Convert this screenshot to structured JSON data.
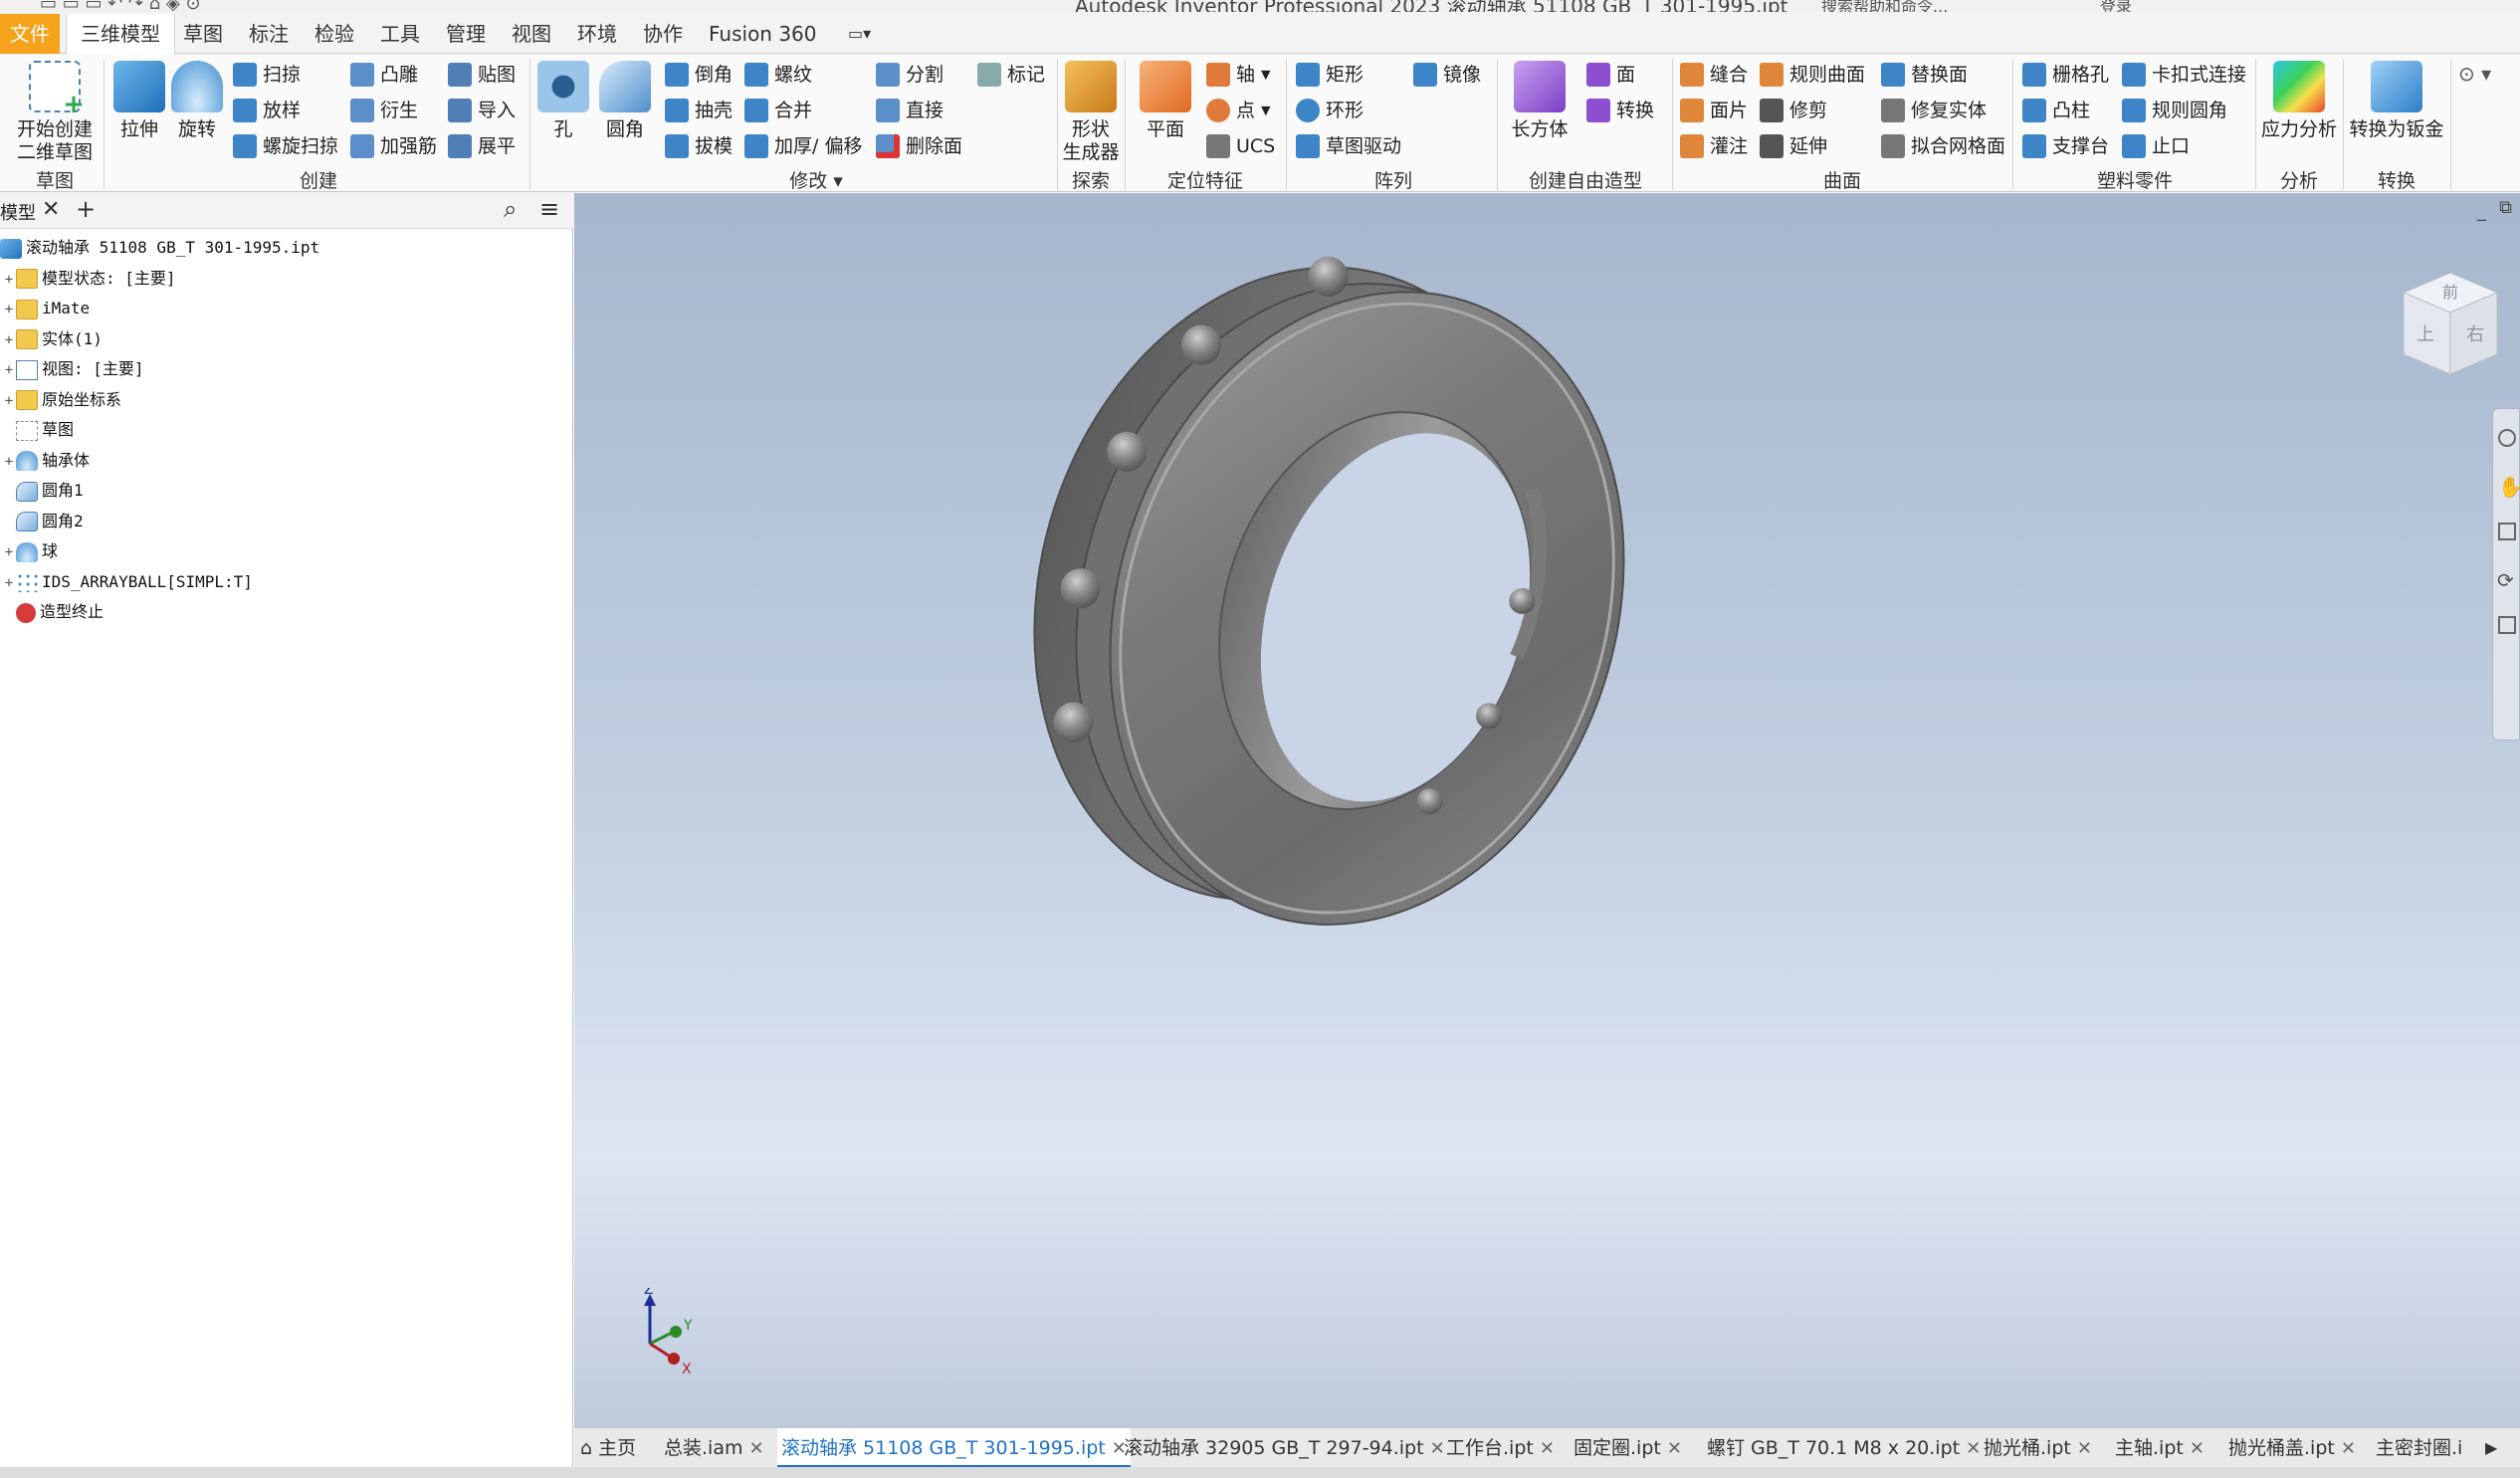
{
  "titlebar": {
    "title": "Autodesk Inventor Professional 2023   滚动轴承 51108 GB_T 301-1995.ipt",
    "search": "搜索帮助和命令...",
    "signin": "登录"
  },
  "menu": {
    "file": "文件",
    "tabs": [
      "三维模型",
      "草图",
      "标注",
      "检验",
      "工具",
      "管理",
      "视图",
      "环境",
      "协作",
      "Fusion 360"
    ],
    "active_tab": "三维模型"
  },
  "ribbon": {
    "sketch": {
      "start_2d": "开始创建\n二维草图",
      "group": "草图"
    },
    "create": {
      "extrude": "拉伸",
      "revolve": "旋转",
      "sweep": "扫掠",
      "loft": "放样",
      "coil": "螺旋扫掠",
      "emboss": "凸雕",
      "derive": "衍生",
      "rib": "加强筋",
      "decal": "贴图",
      "import": "导入",
      "unfold": "展平",
      "group": "创建"
    },
    "modify": {
      "hole": "孔",
      "fillet": "圆角",
      "chamfer": "倒角",
      "shell": "抽壳",
      "draft": "拔模",
      "thread": "螺纹",
      "combine": "合并",
      "thicken": "加厚/ 偏移",
      "split": "分割",
      "direct": "直接",
      "delete_face": "删除面",
      "mark": "标记",
      "group": "修改"
    },
    "explore": {
      "shape_gen": "形状\n生成器",
      "group": "探索"
    },
    "work": {
      "plane": "平面",
      "axis": "轴",
      "point": "点",
      "ucs": "UCS",
      "group": "定位特征"
    },
    "pattern": {
      "rect": "矩形",
      "circ": "环形",
      "sketch_driven": "草图驱动",
      "mirror": "镜像",
      "group": "阵列"
    },
    "freeform": {
      "box": "长方体",
      "face": "面",
      "convert": "转换",
      "group": "创建自由造型"
    },
    "surface": {
      "stitch": "缝合",
      "patch": "面片",
      "sculpt": "灌注",
      "ruled": "规则曲面",
      "trim": "修剪",
      "extend": "延伸",
      "replace": "替换面",
      "repair": "修复实体",
      "fit_mesh": "拟合网格面",
      "group": "曲面"
    },
    "plastic": {
      "grill": "栅格孔",
      "boss": "凸柱",
      "rest": "支撑台",
      "snap": "卡扣式连接",
      "rule_fillet": "规则圆角",
      "lip": "止口",
      "group": "塑料零件"
    },
    "analysis": {
      "stress": "应力分析",
      "group": "分析"
    },
    "convert": {
      "to_sheet": "转换为钣金",
      "group": "转换"
    }
  },
  "browser": {
    "tab_label": "模型",
    "rows": [
      {
        "label": "滚动轴承 51108 GB_T 301-1995.ipt",
        "icon": "part-icon",
        "exp": ""
      },
      {
        "label": "模型状态: [主要]",
        "icon": "folder-icon",
        "exp": "+"
      },
      {
        "label": "iMate",
        "icon": "folder-icon",
        "exp": "+"
      },
      {
        "label": "实体(1)",
        "icon": "folder-icon",
        "exp": "+"
      },
      {
        "label": "视图: [主要]",
        "icon": "view-icon",
        "exp": "+"
      },
      {
        "label": "原始坐标系",
        "icon": "folder-icon",
        "exp": "+"
      },
      {
        "label": "草图",
        "icon": "sketch-icon",
        "exp": ""
      },
      {
        "label": "轴承体",
        "icon": "revolve-icon",
        "exp": "+"
      },
      {
        "label": "圆角1",
        "icon": "fillet-icon",
        "exp": ""
      },
      {
        "label": "圆角2",
        "icon": "fillet-icon",
        "exp": ""
      },
      {
        "label": "球",
        "icon": "revolve-icon",
        "exp": "+"
      },
      {
        "label": "IDS_ARRAYBALL[SIMPL:T]",
        "icon": "pattern-icon",
        "exp": "+"
      },
      {
        "label": "造型终止",
        "icon": "end-of-part-icon",
        "exp": ""
      }
    ]
  },
  "viewcube": {
    "face_top": "前",
    "face_left": "上",
    "face_right": "右"
  },
  "triad": {
    "z": "Z",
    "y": "Y",
    "x": "X"
  },
  "doc_tabs": {
    "home": "主页",
    "tabs": [
      "总装.iam",
      "滚动轴承 51108 GB_T 301-1995.ipt",
      "滚动轴承 32905 GB_T 297-94.ipt",
      "工作台.ipt",
      "固定圈.ipt",
      "螺钉 GB_T 70.1 M8 x 20.ipt",
      "抛光桶.ipt",
      "主轴.ipt",
      "抛光桶盖.ipt",
      "主密封圈.i"
    ],
    "active": "滚动轴承 51108 GB_T 301-1995.ipt"
  },
  "colors": {
    "file_tab": "#f6a21a",
    "accent_blue": "#1e72c7",
    "bearing_gray": "#7a7a7a"
  }
}
